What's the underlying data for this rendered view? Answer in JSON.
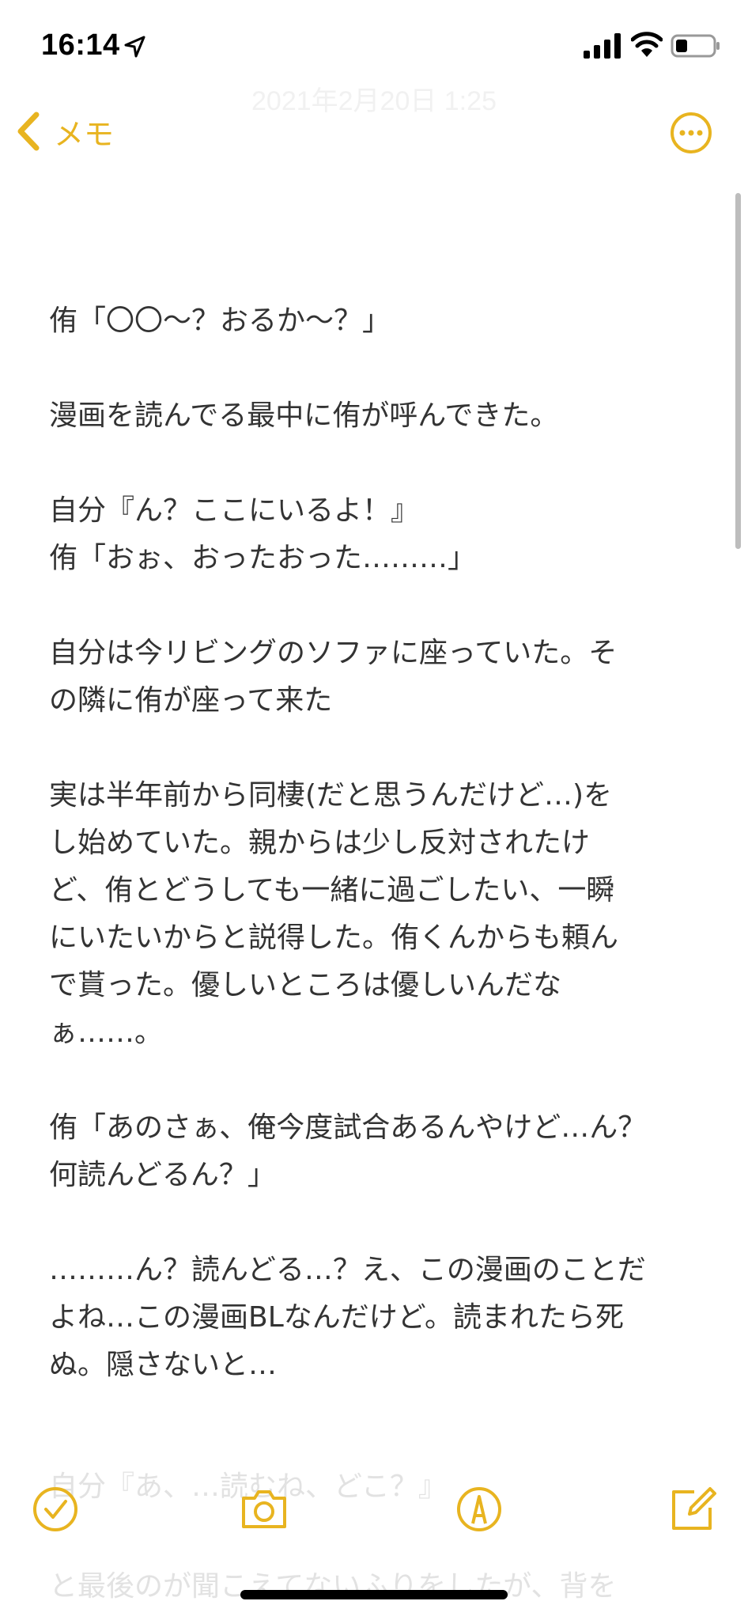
{
  "status_bar": {
    "time": "16:14",
    "icons": [
      "location-arrow-icon",
      "cellular-signal-icon",
      "wifi-icon",
      "battery-icon"
    ]
  },
  "nav": {
    "faint_date": "2021年2月20日 1:25",
    "back_label": "メモ",
    "more_icon": "ellipsis-circle-icon"
  },
  "note": {
    "lines": [
      "侑「〇〇〜？おるか〜？」",
      "",
      "漫画を読んでる最中に侑が呼んできた。",
      "",
      "自分『ん？ここにいるよ！』",
      "侑「おぉ、おったおった………」",
      "",
      "自分は今リビングのソファに座っていた。そ",
      "の隣に侑が座って来た",
      "",
      "実は半年前から同棲(だと思うんだけど…)を",
      "し始めていた。親からは少し反対されたけ",
      "ど、侑とどうしても一緒に過ごしたい、一瞬",
      "にいたいからと説得した。侑くんからも頼ん",
      "で貰った。優しいところは優しいんだな",
      "ぁ……。",
      "",
      "侑「あのさぁ、俺今度試合あるんやけど…ん？",
      "何読んどるん？」",
      "",
      "………ん？読んどる…？え、この漫画のことだ",
      "よね…この漫画BLなんだけど。読まれたら死",
      "ぬ。隠さないと…"
    ],
    "faded_line_1": "自分『あ、…読むね、どこ？』",
    "faded_line_2": "と最後のが聞こえてないふりをしたが、背を"
  },
  "toolbar": {
    "icons": [
      "checklist-icon",
      "camera-icon",
      "markup-pen-icon",
      "compose-icon"
    ]
  },
  "colors": {
    "accent": "#e8b420",
    "text": "#333333",
    "background": "#ffffff"
  }
}
